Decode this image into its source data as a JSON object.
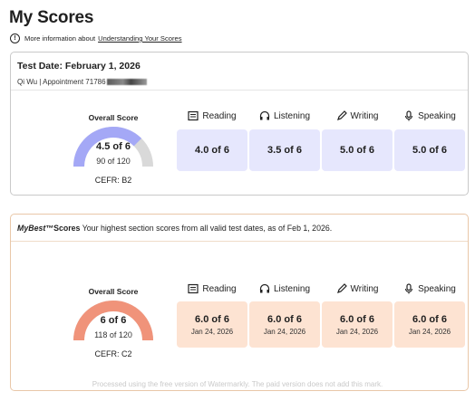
{
  "page": {
    "title": "My Scores",
    "info_prefix": "More information about",
    "info_link": "Understanding Your Scores"
  },
  "test": {
    "date_label": "Test Date: February 1, 2026",
    "candidate": "Qi Wu  |  Appointment 71786",
    "overall": {
      "label": "Overall Score",
      "band": "4.5 of 6",
      "raw": "90 of 120",
      "cefr": "CEFR: B2",
      "fraction": 0.75
    },
    "skills": [
      {
        "name": "Reading",
        "icon": "book-icon",
        "band": "4.0 of 6"
      },
      {
        "name": "Listening",
        "icon": "headphones-icon",
        "band": "3.5 of 6"
      },
      {
        "name": "Writing",
        "icon": "pencil-icon",
        "band": "5.0 of 6"
      },
      {
        "name": "Speaking",
        "icon": "microphone-icon",
        "band": "5.0 of 6"
      }
    ]
  },
  "mybest": {
    "brand": "MyBest™",
    "brand_suffix": "Scores",
    "description": "Your highest section scores from all valid test dates, as of Feb 1, 2026.",
    "overall": {
      "label": "Overall Score",
      "band": "6 of 6",
      "raw": "118 of 120",
      "cefr": "CEFR: C2",
      "fraction": 1.0
    },
    "skills": [
      {
        "name": "Reading",
        "icon": "book-icon",
        "band": "6.0 of 6",
        "date": "Jan 24, 2026"
      },
      {
        "name": "Listening",
        "icon": "headphones-icon",
        "band": "6.0 of 6",
        "date": "Jan 24, 2026"
      },
      {
        "name": "Writing",
        "icon": "pencil-icon",
        "band": "6.0 of 6",
        "date": "Jan 24, 2026"
      },
      {
        "name": "Speaking",
        "icon": "microphone-icon",
        "band": "6.0 of 6",
        "date": "Jan 24, 2026"
      }
    ]
  },
  "colors": {
    "gauge_test": "#a4a8f6",
    "gauge_track": "#d9d9d9",
    "gauge_best": "#f0937a",
    "tile_test": "#e6e7fd",
    "tile_best": "#fde3d2",
    "best_border": "#e9c7a8"
  },
  "watermark": "Processed using the free version of Watermarkly. The paid version does not add this mark."
}
